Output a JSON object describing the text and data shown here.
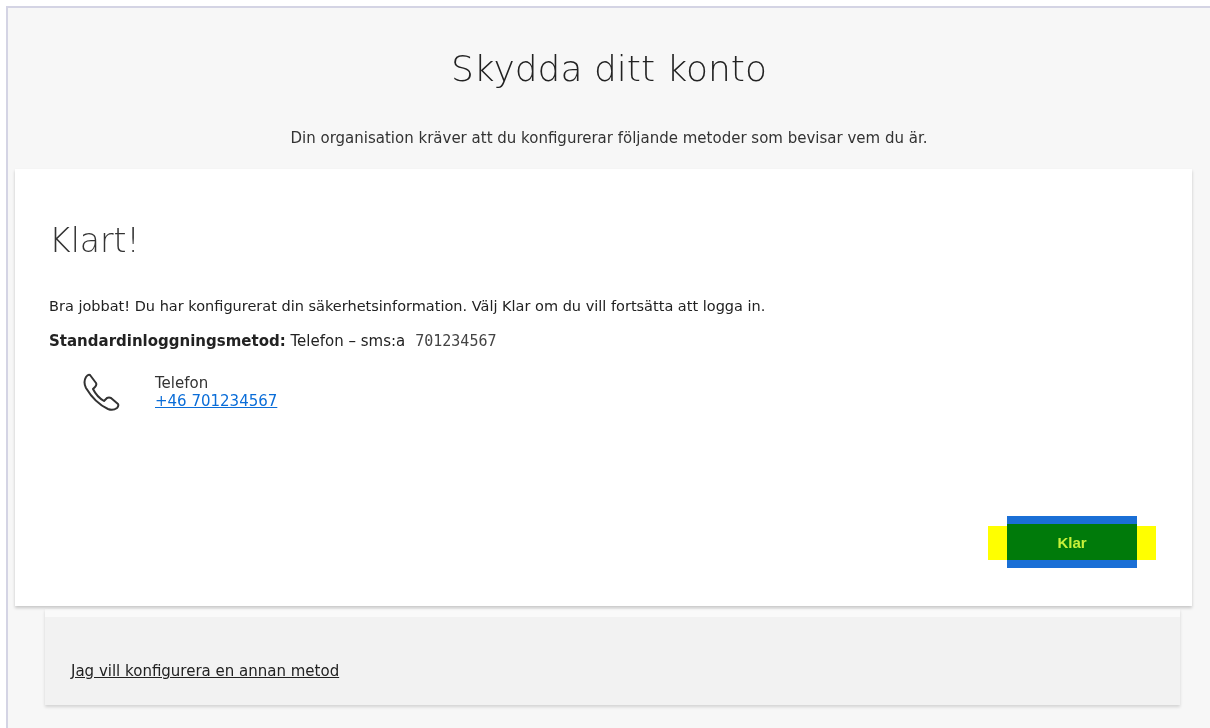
{
  "header": {
    "title": "Skydda ditt konto",
    "subtitle": "Din organisation kräver att du konfigurerar följande metoder som bevisar vem du är."
  },
  "card": {
    "heading": "Klart!",
    "message": "Bra jobbat! Du har konfigurerat din säkerhetsinformation. Välj Klar om du vill fortsätta att logga in.",
    "default_method": "**Standardinloggningsmetod:** Telefon – sms:a",
    "default_number": "701234567",
    "methods": [
      {
        "kind": "phone",
        "label": "Telefon",
        "value": "+46 701234567"
      }
    ],
    "button": {
      "label": "Klar",
      "highlighted": true
    }
  },
  "footer": {
    "link": "Jag vill konfigurera en annan metod"
  }
}
